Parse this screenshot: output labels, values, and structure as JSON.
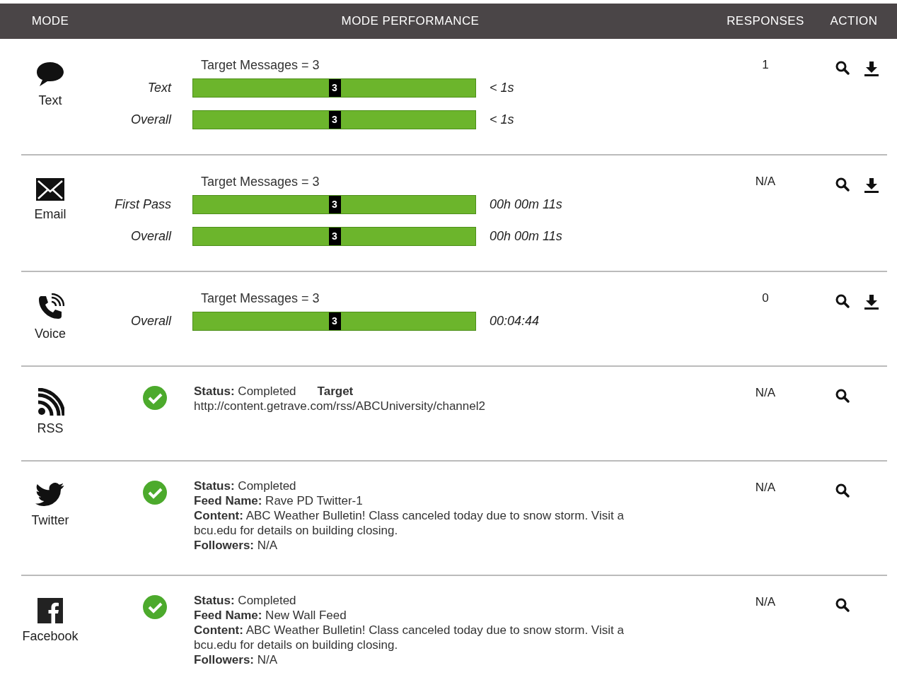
{
  "header": {
    "columns": [
      "MODE",
      "MODE PERFORMANCE",
      "RESPONSES",
      "ACTION"
    ]
  },
  "rows": [
    {
      "kind": "text",
      "mode": "Text",
      "target": "Target Messages = 3",
      "bars": [
        {
          "label": "Text",
          "value": "3",
          "level": 0.5,
          "reading": "< 1s"
        },
        {
          "label": "Overall",
          "value": "3",
          "level": 0.5,
          "reading": "< 1s"
        }
      ],
      "responses": "1",
      "downloadable": true
    },
    {
      "kind": "email",
      "mode": "Email",
      "target": "Target Messages = 3",
      "bars": [
        {
          "label": "First Pass",
          "value": "3",
          "level": 0.5,
          "reading": "00h 00m 11s"
        },
        {
          "label": "Overall",
          "value": "3",
          "level": 0.5,
          "reading": "00h 00m 11s"
        }
      ],
      "responses": "N/A",
      "downloadable": true
    },
    {
      "kind": "voice",
      "mode": "Voice",
      "target": "Target Messages = 3",
      "bars": [
        {
          "label": "Overall",
          "value": "3",
          "level": 0.5,
          "reading": "00:04:44"
        }
      ],
      "responses": "0",
      "downloadable": true
    },
    {
      "kind": "rss",
      "mode": "RSS",
      "completed": true,
      "lines": [
        [
          {
            "label": "Status:",
            "value": "Completed"
          },
          {
            "label": "Target"
          }
        ],
        [
          {
            "value": "http://content.getrave.com/rss/ABCUniversity/channel2"
          }
        ]
      ],
      "responses": "N/A",
      "downloadable": false
    },
    {
      "kind": "twitter",
      "mode": "Twitter",
      "completed": true,
      "lines": [
        [
          {
            "label": "Status:",
            "value": "Completed"
          }
        ],
        [
          {
            "label": "Feed Name:",
            "value": "Rave PD Twitter-1"
          }
        ],
        [
          {
            "label": "Content:",
            "value": "ABC Weather Bulletin! Class canceled today due to snow storm. Visit a bcu.edu for details on building closing."
          }
        ],
        [
          {
            "label": "Followers:",
            "value": "N/A"
          }
        ]
      ],
      "responses": "N/A",
      "downloadable": false
    },
    {
      "kind": "facebook",
      "mode": "Facebook",
      "completed": true,
      "lines": [
        [
          {
            "label": "Status:",
            "value": "Completed"
          }
        ],
        [
          {
            "label": "Feed Name:",
            "value": "New Wall Feed"
          }
        ],
        [
          {
            "label": "Content:",
            "value": "ABC Weather Bulletin! Class canceled today due to snow storm. Visit a bcu.edu for details on building closing."
          }
        ],
        [
          {
            "label": "Followers:",
            "value": "N/A"
          }
        ]
      ],
      "responses": "N/A",
      "downloadable": false
    }
  ]
}
